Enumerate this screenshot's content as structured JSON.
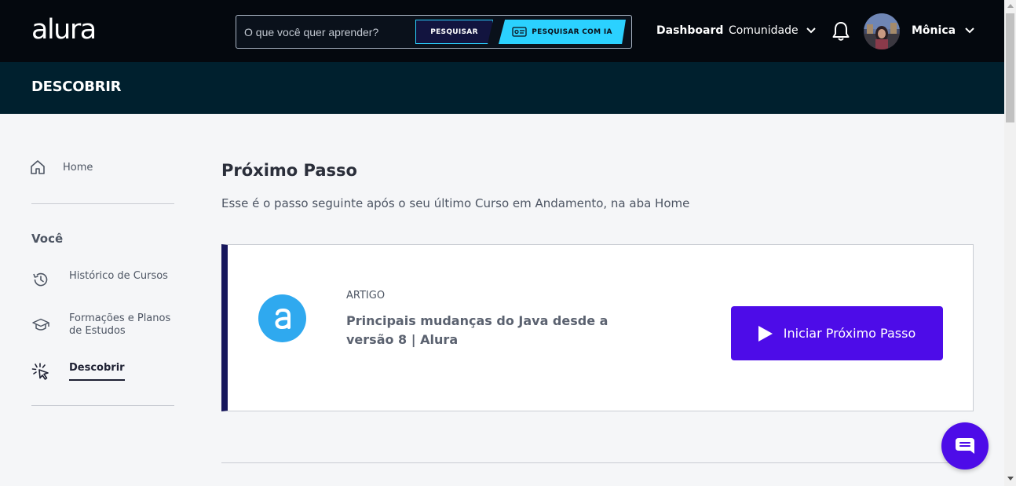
{
  "header": {
    "logo_text": "alura",
    "search": {
      "placeholder": "O que você quer aprender?",
      "value": "",
      "button_label": "PESQUISAR",
      "ia_button_label": "PESQUISAR COM IA"
    },
    "nav": {
      "dashboard": "Dashboard",
      "comunidade": "Comunidade"
    },
    "user": {
      "name": "Mônica"
    },
    "icons": {
      "bell": "bell-icon",
      "chevron": "chevron-down-icon",
      "ia": "ticket-icon"
    }
  },
  "subheader": {
    "title": "DESCOBRIR"
  },
  "sidebar": {
    "home_label": "Home",
    "section_title": "Você",
    "items": [
      {
        "label": "Histórico de Cursos",
        "icon": "history-icon"
      },
      {
        "label": "Formações e Planos de Estudos",
        "icon": "graduation-cap-icon"
      },
      {
        "label": "Descobrir",
        "icon": "sparkle-cursor-icon",
        "active": true
      }
    ]
  },
  "main": {
    "title": "Próximo Passo",
    "description": "Esse é o passo seguinte após o seu último Curso em Andamento, na aba Home",
    "card": {
      "type": "ARTIGO",
      "title": "Principais mudanças do Java desde a versão 8 | Alura",
      "button_label": "Iniciar Próximo Passo",
      "logo_letter": "a"
    }
  },
  "colors": {
    "header_bg": "#04080e",
    "subheader_bg": "#00202e",
    "accent_cyan": "#2bd1ff",
    "primary_purple": "#4d0ce8",
    "card_border_left": "#16165c",
    "logo_blue": "#2fa9ef"
  }
}
